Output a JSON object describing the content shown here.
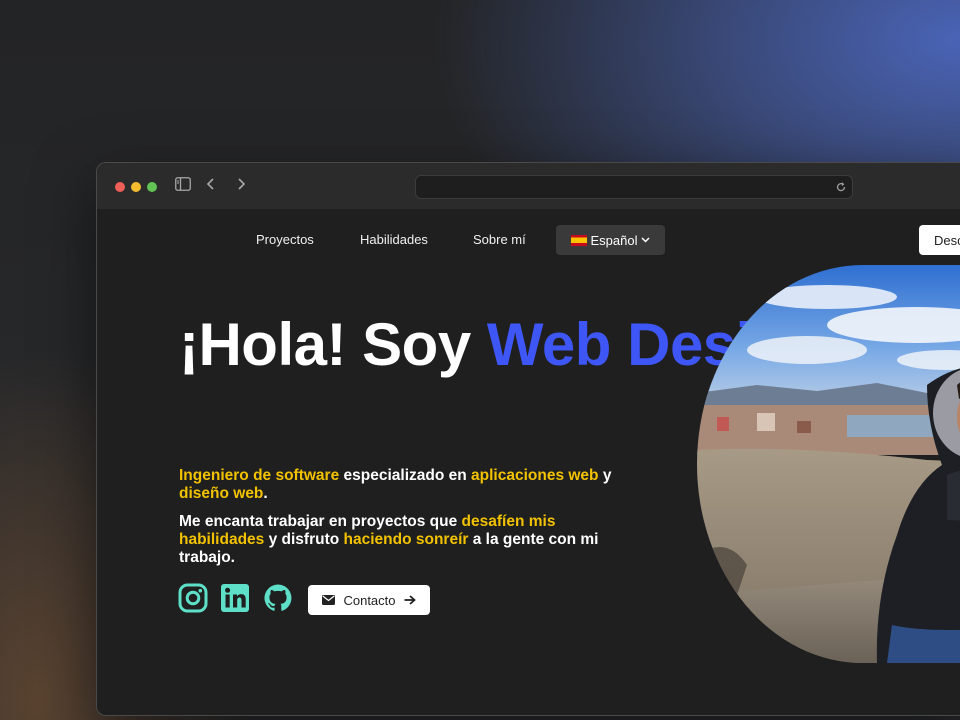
{
  "browser": {
    "address": "",
    "traffic_lights": {
      "close": "#ee5f57",
      "minimize": "#f5bd2e",
      "zoom": "#61c454"
    }
  },
  "nav": {
    "links": [
      "Proyectos",
      "Habilidades",
      "Sobre mí"
    ],
    "language": "Español",
    "download_label": "Desc"
  },
  "hero": {
    "title_white": "¡Hola! Soy",
    "title_blue": "Web Designer",
    "p1": [
      {
        "text": "Ingeniero de software",
        "hl": true
      },
      {
        "text": " especializado en ",
        "hl": false
      },
      {
        "text": "aplicaciones web",
        "hl": true
      },
      {
        "text": " y ",
        "hl": false
      },
      {
        "text": "diseño web",
        "hl": true
      },
      {
        "text": ".",
        "hl": false
      }
    ],
    "p2": [
      {
        "text": "Me encanta trabajar en proyectos que ",
        "hl": false
      },
      {
        "text": "desafíen mis habilidades",
        "hl": true
      },
      {
        "text": " y disfruto ",
        "hl": false
      },
      {
        "text": "haciendo sonreír",
        "hl": true
      },
      {
        "text": " a la gente con mi trabajo.",
        "hl": false
      }
    ],
    "contact_label": "Contacto"
  },
  "social": [
    "instagram-icon",
    "linkedin-icon",
    "github-icon"
  ],
  "colors": {
    "accent_blue": "#3d56f5",
    "highlight_yellow": "#f2c200",
    "social_teal": "#5ee0c8",
    "page_bg": "#1f1f1f"
  }
}
